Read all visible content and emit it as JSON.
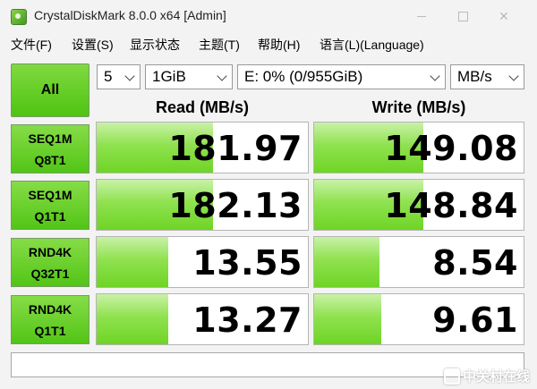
{
  "window": {
    "title": "CrystalDiskMark 8.0.0 x64 [Admin]"
  },
  "menu": [
    {
      "label": "文件(F)"
    },
    {
      "label": "设置(S)"
    },
    {
      "label": "显示状态"
    },
    {
      "label": "主题(T)"
    },
    {
      "label": "帮助(H)"
    },
    {
      "label": "语言(L)(Language)"
    }
  ],
  "controls": {
    "all_label": "All",
    "count": "5",
    "size": "1GiB",
    "drive": "E: 0% (0/955GiB)",
    "unit": "MB/s"
  },
  "headers": {
    "read": "Read (MB/s)",
    "write": "Write (MB/s)"
  },
  "results": [
    {
      "line1": "SEQ1M",
      "line2": "Q8T1",
      "read": "181.97",
      "write": "149.08",
      "read_fill": 0.55,
      "write_fill": 0.52
    },
    {
      "line1": "SEQ1M",
      "line2": "Q1T1",
      "read": "182.13",
      "write": "148.84",
      "read_fill": 0.55,
      "write_fill": 0.52
    },
    {
      "line1": "RND4K",
      "line2": "Q32T1",
      "read": "13.55",
      "write": "8.54",
      "read_fill": 0.34,
      "write_fill": 0.31
    },
    {
      "line1": "RND4K",
      "line2": "Q1T1",
      "read": "13.27",
      "write": "9.61",
      "read_fill": 0.34,
      "write_fill": 0.32
    }
  ],
  "comment": "",
  "watermark": "中关村在线",
  "colors": {
    "accent_green": "#4fc312",
    "bar_green": "#8fe24f"
  }
}
